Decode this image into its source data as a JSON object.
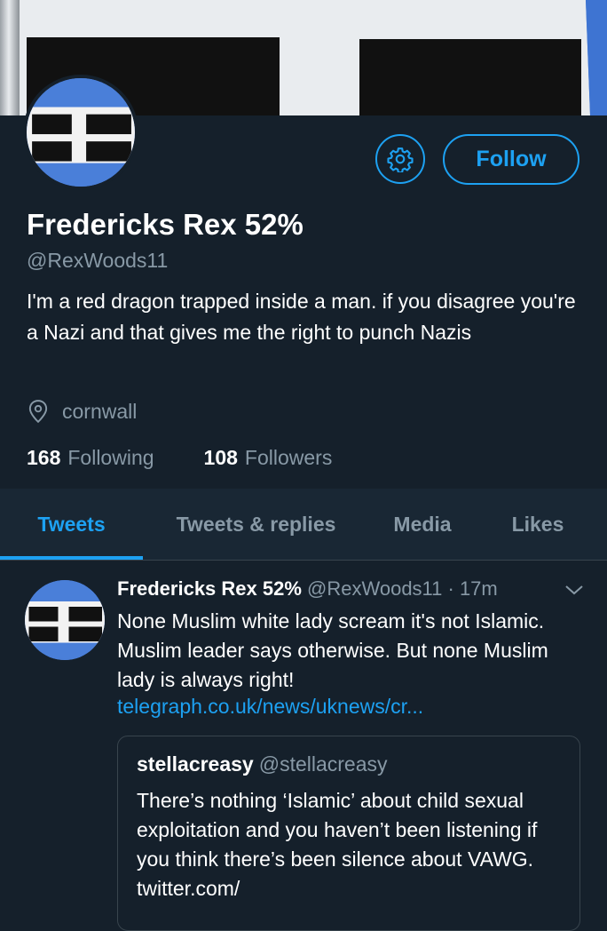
{
  "profile": {
    "display_name": "Fredericks Rex 52%",
    "handle": "@RexWoods11",
    "bio": "I'm a red dragon trapped inside a man. if you disagree you're a Nazi and that gives me the right to punch Nazis",
    "location": "cornwall",
    "following_count": "168",
    "following_label": "Following",
    "followers_count": "108",
    "followers_label": "Followers",
    "follow_label": "Follow",
    "settings_icon": "gear-icon",
    "location_icon": "location-pin-icon"
  },
  "tabs": [
    {
      "label": "Tweets",
      "active": true
    },
    {
      "label": "Tweets & replies",
      "active": false
    },
    {
      "label": "Media",
      "active": false
    },
    {
      "label": "Likes",
      "active": false
    }
  ],
  "tweet": {
    "author_name": "Fredericks Rex 52%",
    "meta": "@RexWoods11 · 17m",
    "text": "None Muslim white lady scream it's not Islamic. Muslim leader says otherwise. But none Muslim lady is always right!",
    "link": "telegraph.co.uk/news/uknews/cr...",
    "quote": {
      "author_name": "stellacreasy",
      "handle": "@stellacreasy",
      "text": "There’s nothing ‘Islamic’ about child sexual exploitation and you haven’t been listening if you think there’s been silence about VAWG. twitter.com/"
    }
  },
  "colors": {
    "background": "#15202b",
    "accent": "#1da1f2",
    "secondary_text": "#8899a6"
  }
}
